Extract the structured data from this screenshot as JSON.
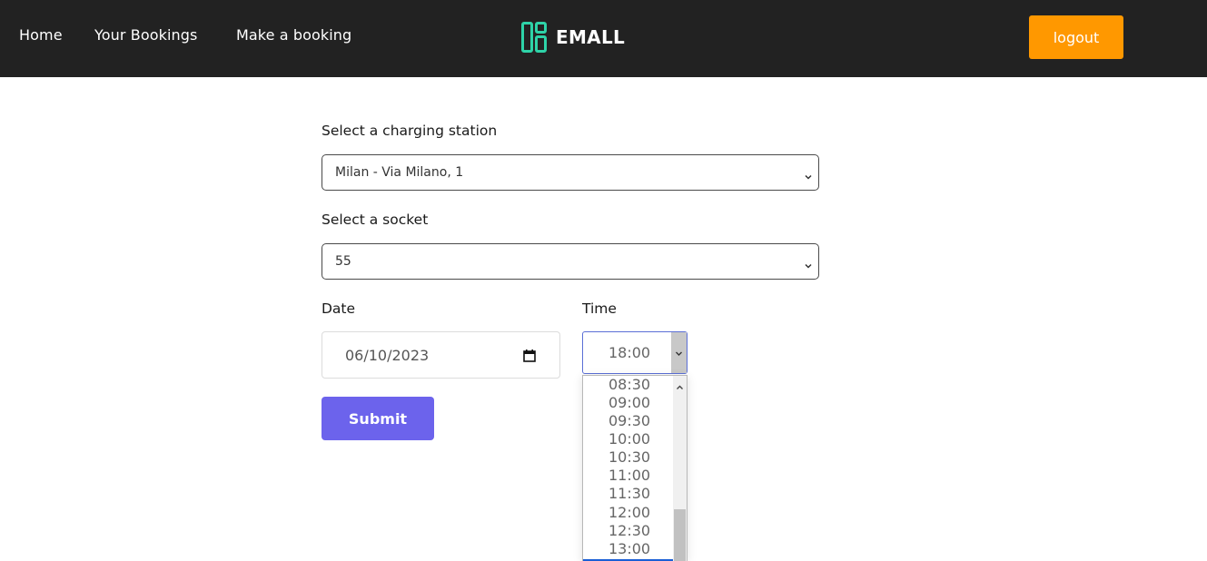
{
  "nav": {
    "links": [
      "Home",
      "Your Bookings",
      "Make a booking"
    ],
    "brand": "EMALL",
    "logout_label": "logout"
  },
  "form": {
    "station_label": "Select a charging station",
    "station_value": "Milan - Via Milano, 1",
    "socket_label": "Select a socket",
    "socket_value": "55",
    "date_label": "Date",
    "date_value": "06/10/2023",
    "time_label": "Time",
    "time_value": "18:00",
    "submit_label": "Submit"
  },
  "time_options": [
    "08:30",
    "09:00",
    "09:30",
    "10:00",
    "10:30",
    "11:00",
    "11:30",
    "12:00",
    "12:30",
    "13:00"
  ],
  "colors": {
    "navbar": "#222222",
    "logout": "#ff9800",
    "submit": "#6c63ec",
    "brand_icon": "#2ed3a8"
  }
}
